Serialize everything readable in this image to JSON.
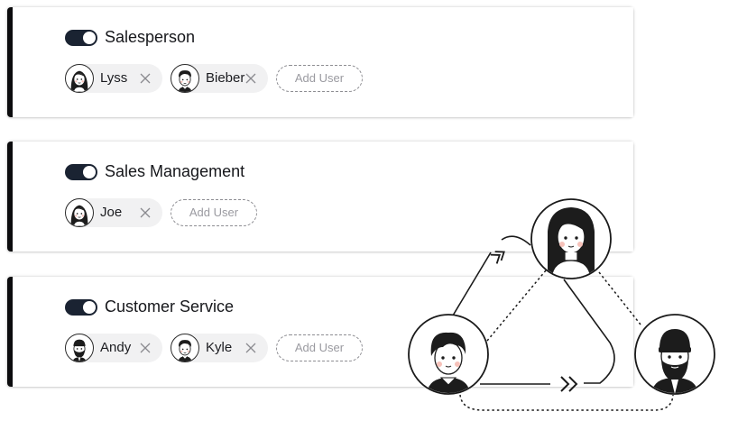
{
  "roles": [
    {
      "title": "Salesperson",
      "enabled": true,
      "users": [
        {
          "name": "Lyss",
          "avatar": "woman-avatar-icon"
        },
        {
          "name": "Bieber",
          "avatar": "man-avatar-icon"
        }
      ],
      "add_label": "Add User"
    },
    {
      "title": "Sales Management",
      "enabled": true,
      "users": [
        {
          "name": "Joe",
          "avatar": "woman-avatar-icon"
        }
      ],
      "add_label": "Add User"
    },
    {
      "title": "Customer Service",
      "enabled": true,
      "users": [
        {
          "name": "Andy",
          "avatar": "bearded-man-avatar-icon"
        },
        {
          "name": "Kyle",
          "avatar": "man-avatar-icon"
        }
      ],
      "add_label": "Add User"
    }
  ],
  "colors": {
    "toggle_on": "#1a2332",
    "card_accent": "#0c0c0e",
    "chip_bg": "#f1f1f2",
    "cheek": "#f6c1b9"
  },
  "illustration": {
    "nodes": [
      "woman-avatar-icon",
      "man-avatar-icon",
      "bearded-man-avatar-icon"
    ],
    "arrows": [
      "double-chevron-up-right-icon",
      "double-chevron-right-icon"
    ]
  }
}
